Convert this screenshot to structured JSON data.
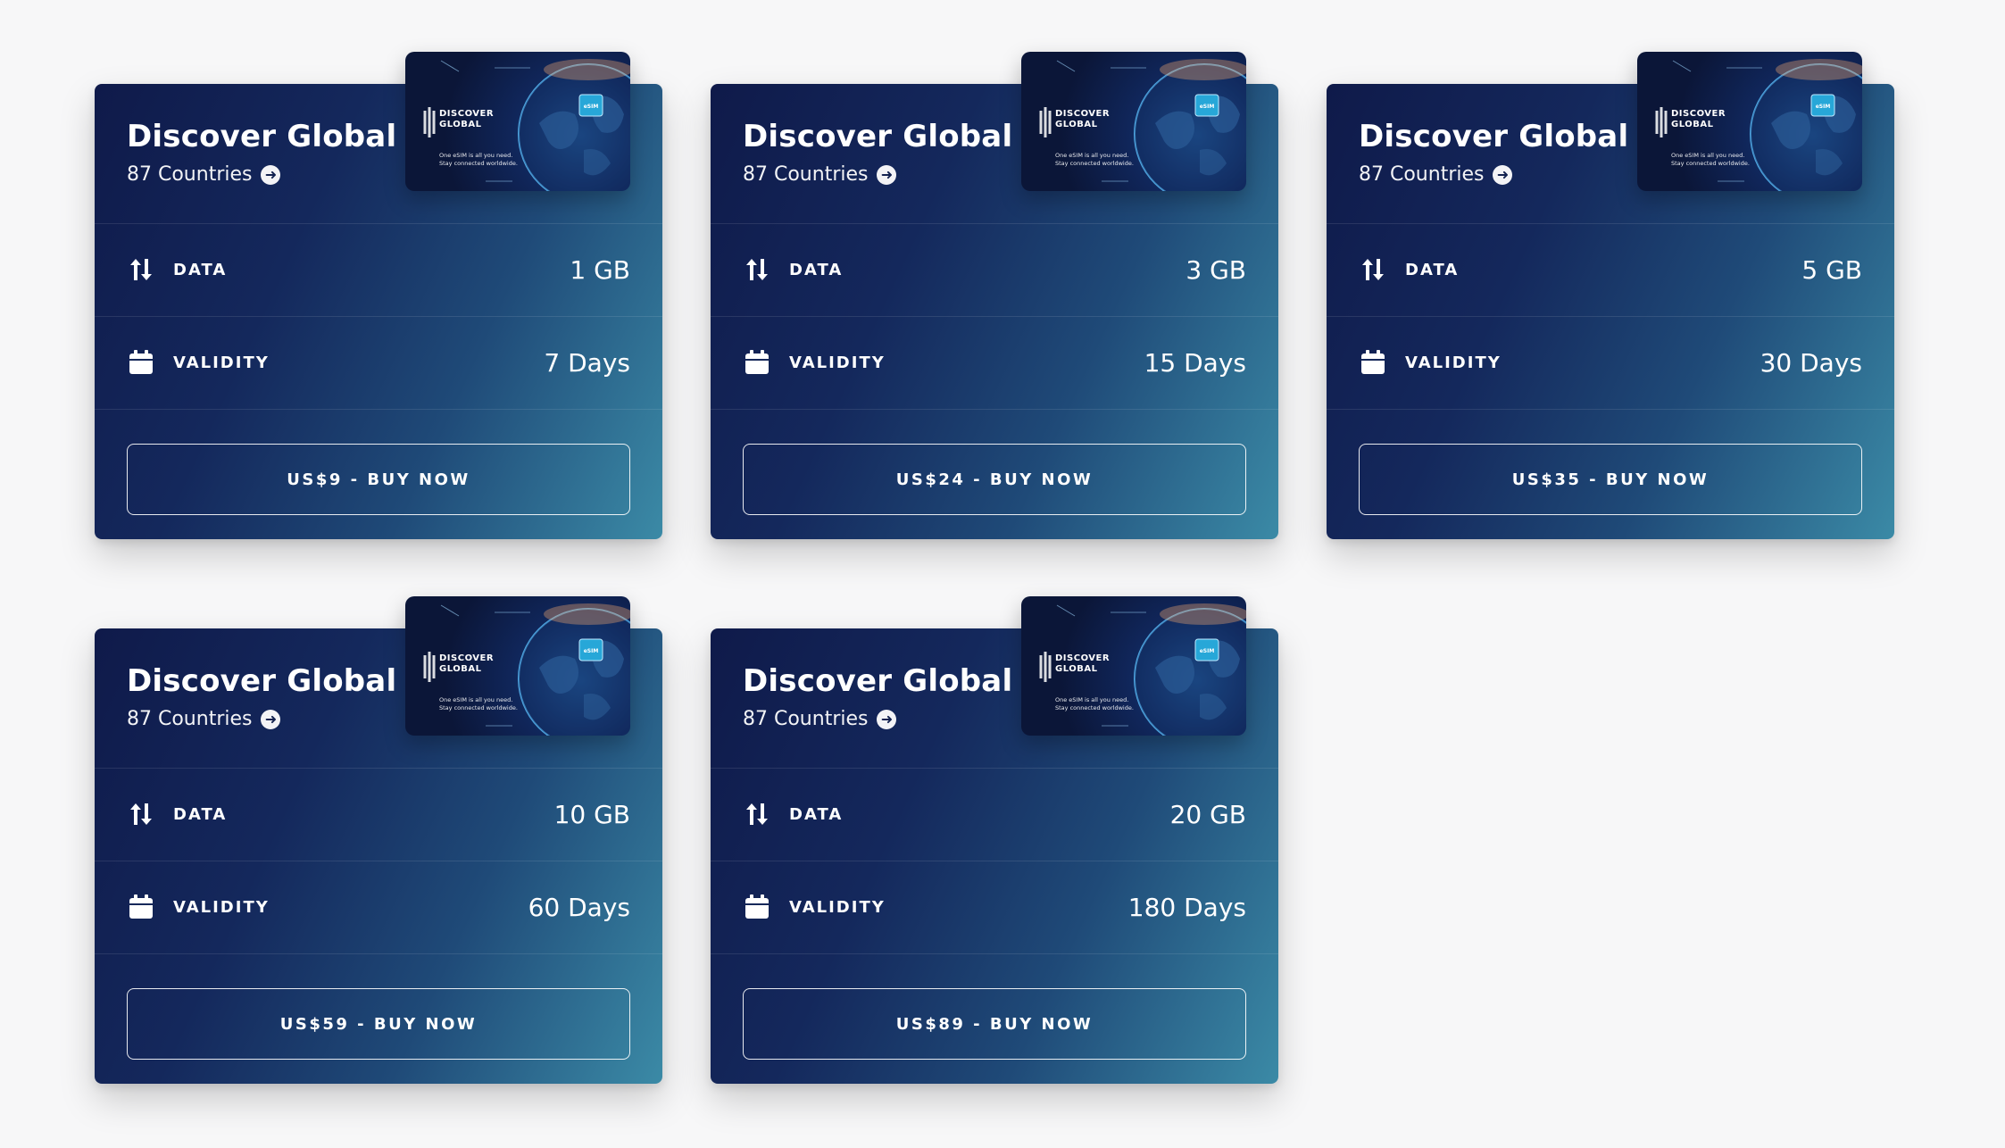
{
  "colors": {
    "background": "#f7f7f8",
    "card_gradient_start": "#0f1a4a",
    "card_gradient_end": "#3b8aa6",
    "text": "#ffffff"
  },
  "labels": {
    "data": "DATA",
    "validity": "VALIDITY"
  },
  "esim_image": {
    "brand_line1": "DISCOVER",
    "brand_line2": "GLOBAL",
    "chip_label": "eSIM",
    "tagline_line1": "One eSIM is all you need.",
    "tagline_line2": "Stay connected worldwide."
  },
  "plans": [
    {
      "title": "Discover Global",
      "countries": "87 Countries",
      "data": "1 GB",
      "validity": "7 Days",
      "button": "US$9 - BUY NOW"
    },
    {
      "title": "Discover Global",
      "countries": "87 Countries",
      "data": "3 GB",
      "validity": "15 Days",
      "button": "US$24 - BUY NOW"
    },
    {
      "title": "Discover Global",
      "countries": "87 Countries",
      "data": "5 GB",
      "validity": "30 Days",
      "button": "US$35 - BUY NOW"
    },
    {
      "title": "Discover Global",
      "countries": "87 Countries",
      "data": "10 GB",
      "validity": "60 Days",
      "button": "US$59 - BUY NOW"
    },
    {
      "title": "Discover Global",
      "countries": "87 Countries",
      "data": "20 GB",
      "validity": "180 Days",
      "button": "US$89 - BUY NOW"
    }
  ]
}
